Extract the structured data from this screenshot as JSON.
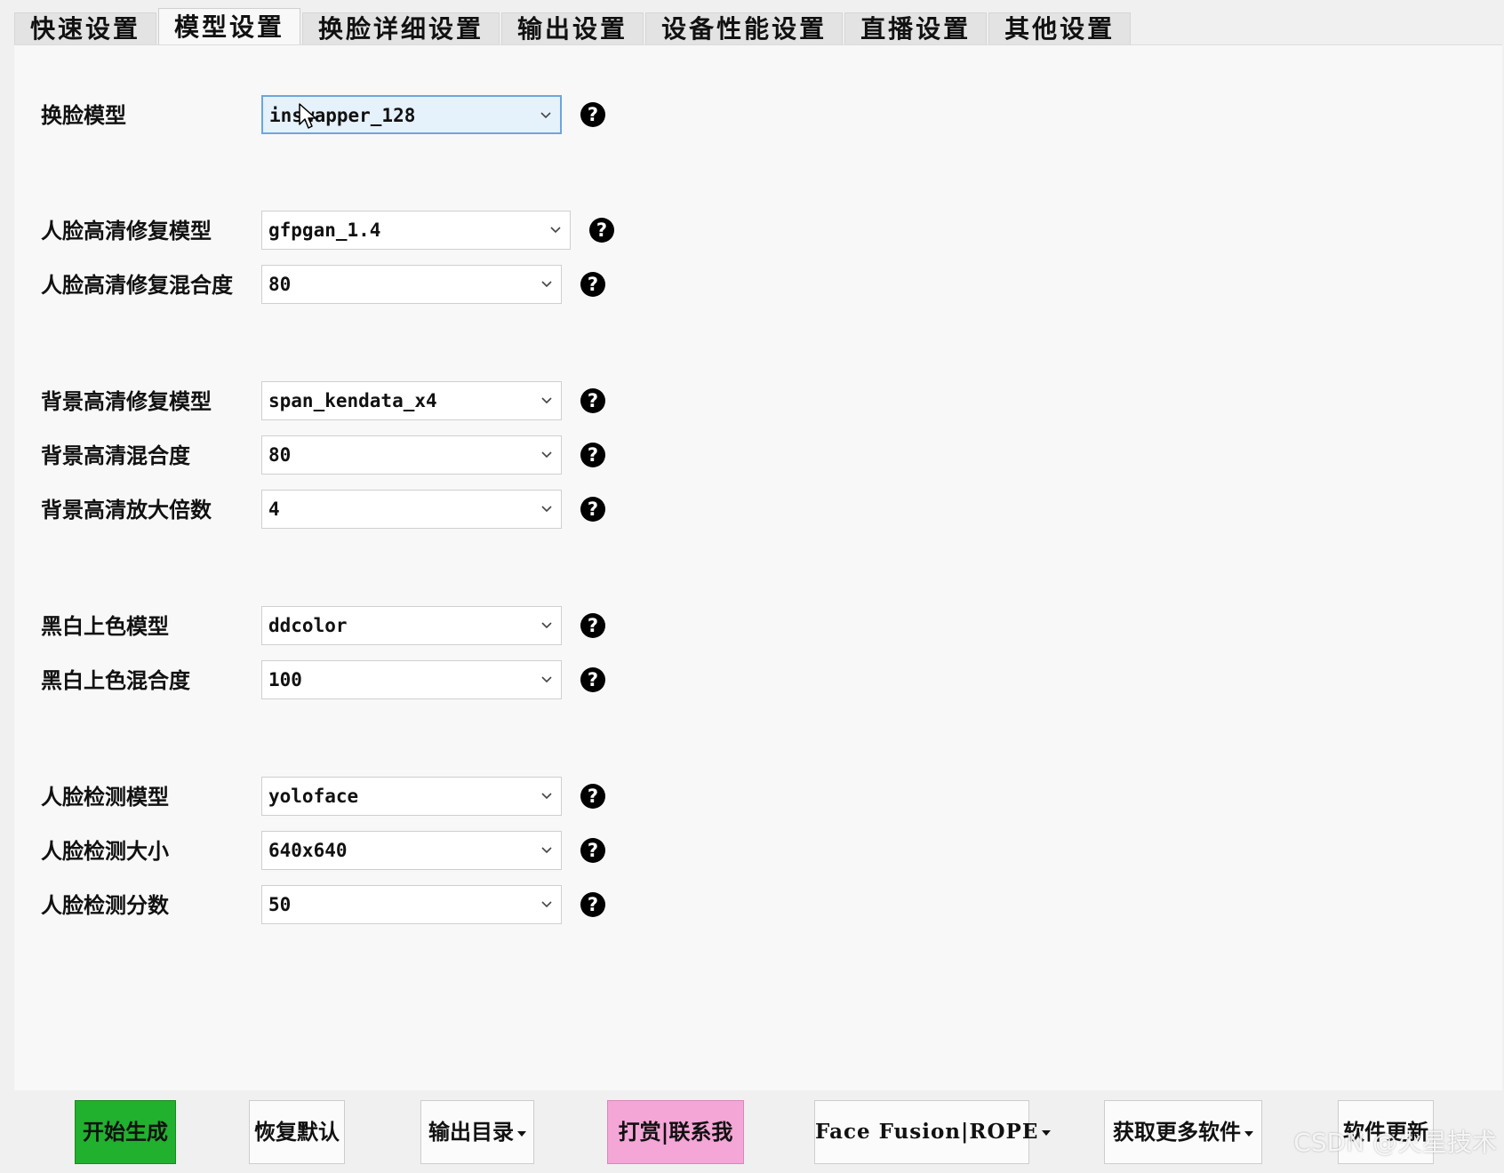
{
  "tabs": [
    {
      "label": "快速设置"
    },
    {
      "label": "模型设置"
    },
    {
      "label": "换脸详细设置"
    },
    {
      "label": "输出设置"
    },
    {
      "label": "设备性能设置"
    },
    {
      "label": "直播设置"
    },
    {
      "label": "其他设置"
    }
  ],
  "active_tab": "模型设置",
  "settings": [
    {
      "label": "换脸模型",
      "value": "inswapper_128"
    },
    {
      "label": "人脸高清修复模型",
      "value": "gfpgan_1.4"
    },
    {
      "label": "人脸高清修复混合度",
      "value": "80"
    },
    {
      "label": "背景高清修复模型",
      "value": "span_kendata_x4"
    },
    {
      "label": "背景高清混合度",
      "value": "80"
    },
    {
      "label": "背景高清放大倍数",
      "value": "4"
    },
    {
      "label": "黑白上色模型",
      "value": "ddcolor"
    },
    {
      "label": "黑白上色混合度",
      "value": "100"
    },
    {
      "label": "人脸检测模型",
      "value": "yoloface"
    },
    {
      "label": "人脸检测大小",
      "value": "640x640"
    },
    {
      "label": "人脸检测分数",
      "value": "50"
    }
  ],
  "help_glyph": "?",
  "buttons": {
    "start": "开始生成",
    "reset": "恢复默认",
    "output_dir": "输出目录",
    "donate": "打赏|联系我",
    "face_fusion": "Face Fusion|ROPE",
    "more_software": "获取更多软件",
    "update": "软件更新"
  },
  "watermark": "CSDN @火星技术",
  "colors": {
    "start_button": "#22b02f",
    "donate_button": "#f4a6d6",
    "focused_combo": "#e5f1fb"
  }
}
